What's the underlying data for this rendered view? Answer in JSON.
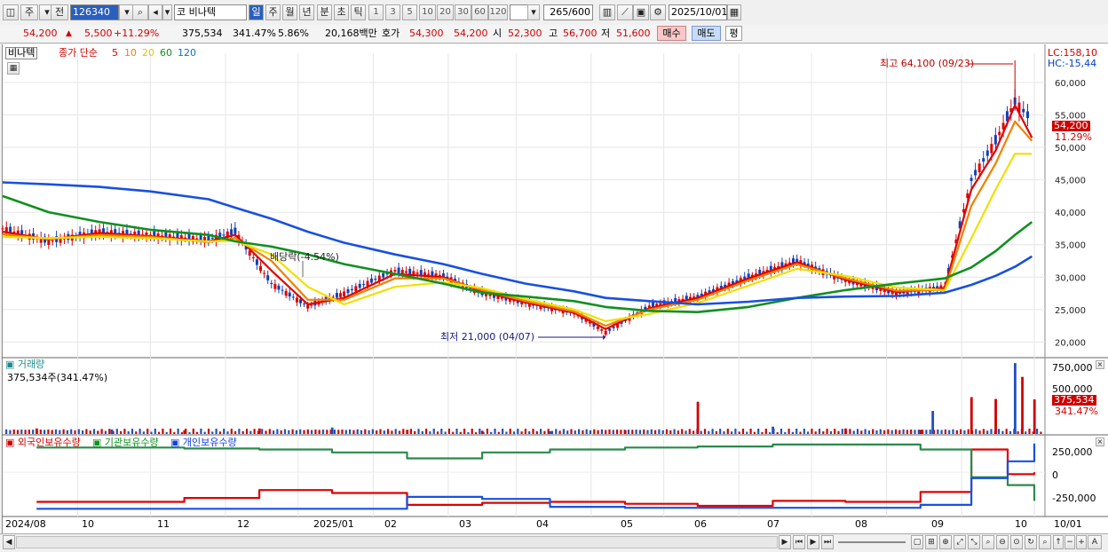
{
  "toolbar": {
    "period_jung": "주",
    "jeon": "전",
    "code": "126340",
    "market": "코",
    "stock_name": "비나텍",
    "periods": [
      "일",
      "주",
      "월",
      "년",
      "분",
      "초",
      "틱"
    ],
    "intervals": [
      "1",
      "3",
      "5",
      "10",
      "20",
      "30",
      "60",
      "120"
    ],
    "count": "265",
    "count_max": "/600",
    "date": "2025/10/01"
  },
  "info": {
    "price": "54,200",
    "change": "5,500",
    "change_pct": "+11.29%",
    "volume": "375,534",
    "volume_pct": "341.47%",
    "turnover": "5.86%",
    "amount": "20,168백만",
    "hoga_label": "호가",
    "hoga1": "54,300",
    "hoga2": "54,200",
    "open_label": "시",
    "open": "52,300",
    "high_label": "고",
    "high": "56,700",
    "low_label": "저",
    "low": "51,600",
    "buy": "매수",
    "sell": "매도",
    "avg": "평"
  },
  "legend": {
    "name": "비나텍",
    "close_label": "종가 단순",
    "ma5": "5",
    "ma10": "10",
    "ma20": "20",
    "ma60": "60",
    "ma120": "120",
    "ma5_color": "#e00000",
    "ma10_color": "#f08000",
    "ma20_color": "#f0e000",
    "ma60_color": "#109020",
    "ma120_color": "#1040e0"
  },
  "annotations": {
    "high": "최고 64,100 (09/23)",
    "low": "최저 21,000 (04/07)",
    "dividend": "배당락(-4.54%)",
    "lc": "LC:158,10",
    "hc": "HC:-15,44",
    "last_price": "54,200",
    "last_pct": "11.29%"
  },
  "volume_panel": {
    "title": "거래량",
    "summary": "375,534주(341.47%)",
    "last": "375,534",
    "last_pct": "341.47%",
    "ticks": [
      "750,000",
      "500,000"
    ]
  },
  "holding_panel": {
    "foreign": "외국인보유수량",
    "institution": "기관보유수량",
    "individual": "개인보유수량",
    "ticks": [
      "250,000",
      "0",
      "-250,000"
    ]
  },
  "x_labels": [
    "2024/08",
    "10",
    "11",
    "12",
    "2025/01",
    "02",
    "03",
    "04",
    "05",
    "06",
    "07",
    "08",
    "09",
    "10",
    "10/01"
  ],
  "chart_data": [
    {
      "type": "line",
      "title": "비나텍",
      "y_ticks": [
        60000,
        55000,
        50000,
        45000,
        40000,
        35000,
        30000,
        25000,
        20000
      ],
      "ylim": [
        18000,
        64500
      ],
      "x": [
        "2024-08-01",
        "2024-08-20",
        "2024-09-10",
        "2024-10-01",
        "2024-10-25",
        "2024-11-05",
        "2024-11-20",
        "2024-12-05",
        "2024-12-20",
        "2025-01-10",
        "2025-01-30",
        "2025-02-15",
        "2025-03-05",
        "2025-03-25",
        "2025-04-07",
        "2025-04-25",
        "2025-05-15",
        "2025-06-05",
        "2025-06-25",
        "2025-07-15",
        "2025-08-05",
        "2025-08-25",
        "2025-09-05",
        "2025-09-15",
        "2025-09-23",
        "2025-09-30"
      ],
      "series": [
        {
          "name": "종가",
          "values": [
            37500,
            35500,
            37000,
            36500,
            35800,
            37000,
            29000,
            25500,
            27500,
            31000,
            30200,
            27500,
            26000,
            24500,
            21500,
            25500,
            27000,
            30000,
            32500,
            29500,
            27500,
            28500,
            45000,
            51000,
            57000,
            54200
          ]
        },
        {
          "name": "5",
          "values": [
            37000,
            35800,
            36800,
            36300,
            35500,
            36500,
            31000,
            25800,
            26800,
            30500,
            30000,
            27800,
            26100,
            24500,
            22000,
            25200,
            26800,
            29800,
            32300,
            29600,
            27700,
            28300,
            43500,
            49500,
            56500,
            51500
          ]
        },
        {
          "name": "10",
          "values": [
            36600,
            35900,
            36500,
            36200,
            35400,
            36000,
            32500,
            26500,
            26500,
            29800,
            29800,
            28000,
            26300,
            24700,
            22500,
            25000,
            26500,
            29500,
            32000,
            29800,
            27900,
            28000,
            41000,
            47500,
            54000,
            51000
          ]
        },
        {
          "name": "20",
          "values": [
            36200,
            36000,
            36200,
            36000,
            35500,
            35600,
            33500,
            28500,
            25800,
            28500,
            29200,
            28300,
            26600,
            25000,
            23200,
            24300,
            26000,
            28700,
            31300,
            30200,
            28400,
            28000,
            36000,
            43500,
            49000,
            49000
          ]
        },
        {
          "name": "60",
          "values": [
            42500,
            40000,
            38500,
            37300,
            36500,
            35500,
            34700,
            33500,
            32000,
            30500,
            29000,
            27600,
            27000,
            26300,
            25400,
            24800,
            24600,
            25400,
            26800,
            28000,
            29000,
            29800,
            31500,
            34000,
            36500,
            38500
          ]
        },
        {
          "name": "120",
          "values": [
            44600,
            44300,
            43900,
            43200,
            42000,
            40700,
            39000,
            37000,
            35300,
            33500,
            32000,
            30500,
            29000,
            27800,
            26800,
            26300,
            25800,
            26200,
            26800,
            27000,
            27100,
            27600,
            28800,
            30200,
            31600,
            33200
          ]
        }
      ]
    },
    {
      "type": "bar",
      "title": "거래량",
      "ylim": [
        0,
        800000
      ],
      "y_ticks": [
        750000,
        500000
      ],
      "x": [
        "2024-08",
        "2024-09",
        "2024-10",
        "2024-11",
        "2024-12",
        "2025-01",
        "2025-02",
        "2025-03",
        "2025-04",
        "2025-05",
        "2025-06",
        "2025-07",
        "2025-08",
        "2025-08-20",
        "2025-09-05",
        "2025-09-15",
        "2025-09-23",
        "2025-09-26",
        "2025-10-01"
      ],
      "values": [
        60000,
        50000,
        40000,
        60000,
        70000,
        45000,
        35000,
        30000,
        40000,
        350000,
        80000,
        60000,
        45000,
        250000,
        400000,
        380000,
        770000,
        620000,
        375534
      ]
    },
    {
      "type": "line",
      "title": "보유수량",
      "ylim": [
        -430000,
        360000
      ],
      "y_ticks": [
        250000,
        0,
        -250000
      ],
      "x": [
        "2024-08",
        "2024-10",
        "2024-11",
        "2024-12",
        "2025-01",
        "2025-02",
        "2025-03",
        "2025-04",
        "2025-05",
        "2025-06",
        "2025-07",
        "2025-08",
        "2025-08-15",
        "2025-09-05",
        "2025-09-20",
        "2025-10-01"
      ],
      "series": [
        {
          "name": "외국인보유수량",
          "values": [
            -300000,
            -260000,
            -180000,
            -210000,
            -330000,
            -310000,
            -300000,
            -320000,
            -340000,
            -290000,
            -300000,
            -290000,
            -200000,
            230000,
            -20000,
            0
          ]
        },
        {
          "name": "기관보유수량",
          "values": [
            250000,
            240000,
            230000,
            200000,
            140000,
            200000,
            230000,
            250000,
            260000,
            280000,
            280000,
            270000,
            230000,
            -50000,
            -130000,
            -290000
          ]
        },
        {
          "name": "개인보유수량",
          "values": [
            -370000,
            -370000,
            -370000,
            -370000,
            -250000,
            -270000,
            -350000,
            -360000,
            -360000,
            -360000,
            -360000,
            -340000,
            -330000,
            -60000,
            110000,
            290000
          ]
        }
      ]
    }
  ]
}
